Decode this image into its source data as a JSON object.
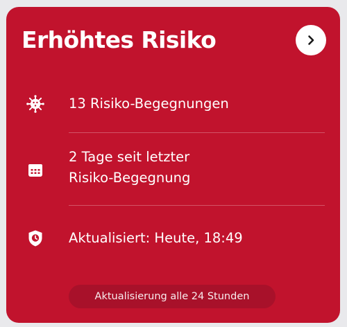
{
  "card": {
    "title": "Erhöhtes Risiko",
    "background_color": "#c1132d",
    "detail_button_icon": "chevron-right-icon"
  },
  "rows": [
    {
      "icon": "virus-icon",
      "text": "13 Risiko-Begegnungen"
    },
    {
      "icon": "calendar-icon",
      "line1": "2 Tage seit letzter",
      "line2": "Risiko-Begegnung"
    },
    {
      "icon": "shield-clock-icon",
      "text": "Aktualisiert: Heute, 18:49"
    }
  ],
  "footer": {
    "text": "Aktualisierung alle 24 Stunden"
  }
}
